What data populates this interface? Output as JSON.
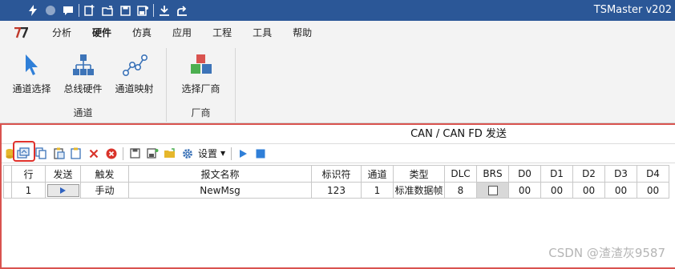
{
  "app": {
    "title": "TSMaster v202"
  },
  "quick_access": [
    "lightning-icon",
    "circle-icon",
    "chat-icon",
    "new-file-icon",
    "open-folder-icon",
    "save-icon",
    "save-as-icon",
    "download-icon",
    "share-icon"
  ],
  "menu": {
    "items": [
      {
        "label": "分析",
        "active": false
      },
      {
        "label": "硬件",
        "active": true
      },
      {
        "label": "仿真",
        "active": false
      },
      {
        "label": "应用",
        "active": false
      },
      {
        "label": "工程",
        "active": false
      },
      {
        "label": "工具",
        "active": false
      },
      {
        "label": "帮助",
        "active": false
      }
    ]
  },
  "ribbon": {
    "groups": [
      {
        "label": "通道",
        "buttons": [
          {
            "label": "通道选择",
            "icon": "cursor-icon"
          },
          {
            "label": "总线硬件",
            "icon": "network-tree-icon"
          },
          {
            "label": "通道映射",
            "icon": "mapping-icon"
          }
        ]
      },
      {
        "label": "厂商",
        "buttons": [
          {
            "label": "选择厂商",
            "icon": "vendor-cubes-icon"
          }
        ]
      }
    ]
  },
  "panel": {
    "title": "CAN / CAN FD 发送",
    "toolbar": {
      "settings_label": "设置"
    }
  },
  "grid": {
    "headers": [
      "行",
      "发送",
      "触发",
      "报文名称",
      "标识符",
      "通道",
      "类型",
      "DLC",
      "BRS",
      "D0",
      "D1",
      "D2",
      "D3",
      "D4"
    ],
    "rows": [
      {
        "row": "1",
        "trigger": "手动",
        "name": "NewMsg",
        "id": "123",
        "channel": "1",
        "type": "标准数据帧",
        "dlc": "8",
        "d0": "00",
        "d1": "00",
        "d2": "00",
        "d3": "00",
        "d4": "00"
      }
    ]
  },
  "watermark": "CSDN @渣渣灰9587",
  "colors": {
    "titlebar": "#2b5797",
    "highlight": "#e0312b",
    "accent": "#2f7fd8"
  }
}
